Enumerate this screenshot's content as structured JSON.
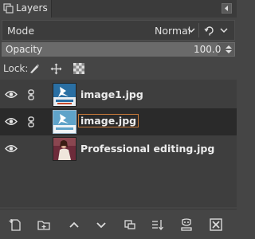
{
  "panel": {
    "tab_label": "Layers"
  },
  "mode": {
    "label": "Mode",
    "value": "Normal"
  },
  "opacity": {
    "label": "Opacity",
    "value": "100.0",
    "fraction": 1.0
  },
  "lock": {
    "label": "Lock:"
  },
  "layers": [
    {
      "name": "image1.jpg",
      "visible": true,
      "linked": true,
      "selected": false,
      "editing": false
    },
    {
      "name": "image.jpg",
      "visible": true,
      "linked": true,
      "selected": true,
      "editing": true
    },
    {
      "name": "Professional editing.jpg",
      "visible": true,
      "linked": false,
      "selected": false,
      "editing": false
    }
  ],
  "toolbar": [
    "new-layer-icon",
    "new-layer-group-icon",
    "raise-layer-icon",
    "lower-layer-icon",
    "duplicate-layer-icon",
    "merge-down-icon",
    "add-mask-icon",
    "delete-layer-icon"
  ],
  "colors": {
    "panel_bg": "#454545",
    "list_bg": "#3e3e3e",
    "selected_row": "#2a2a2a",
    "edit_border": "#c97b3b"
  }
}
